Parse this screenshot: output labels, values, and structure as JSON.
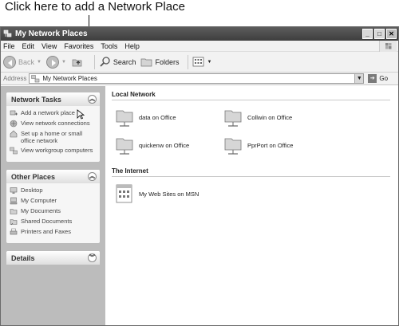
{
  "callout": {
    "text": "Click here to add a Network Place"
  },
  "window": {
    "title": "My Network Places",
    "buttons": {
      "minimize": "_",
      "maximize": "□",
      "close": "✕"
    }
  },
  "menu": [
    "File",
    "Edit",
    "View",
    "Favorites",
    "Tools",
    "Help"
  ],
  "toolbar": {
    "back": "Back",
    "search": "Search",
    "folders": "Folders"
  },
  "address": {
    "label": "Address",
    "value": "My Network Places",
    "go": "Go"
  },
  "sidebar": {
    "network_tasks": {
      "title": "Network Tasks",
      "items": [
        {
          "label": "Add a network place",
          "icon": "add-network-place-icon"
        },
        {
          "label": "View network connections",
          "icon": "network-connections-icon"
        },
        {
          "label": "Set up a home or small office network",
          "icon": "home-network-icon"
        },
        {
          "label": "View workgroup computers",
          "icon": "workgroup-icon"
        }
      ]
    },
    "other_places": {
      "title": "Other Places",
      "items": [
        {
          "label": "Desktop",
          "icon": "desktop-icon"
        },
        {
          "label": "My Computer",
          "icon": "computer-icon"
        },
        {
          "label": "My Documents",
          "icon": "documents-icon"
        },
        {
          "label": "Shared Documents",
          "icon": "shared-documents-icon"
        },
        {
          "label": "Printers and Faxes",
          "icon": "printer-icon"
        }
      ]
    },
    "details": {
      "title": "Details"
    }
  },
  "content": {
    "local_network": {
      "title": "Local Network",
      "items": [
        {
          "label": "data on Office"
        },
        {
          "label": "Collwin on Office"
        },
        {
          "label": "quickenw on Office"
        },
        {
          "label": "PprPort on Office"
        }
      ]
    },
    "internet": {
      "title": "The Internet",
      "items": [
        {
          "label": "My Web Sites on MSN"
        }
      ]
    }
  },
  "colors": {
    "titlebar": "#4a4a4a",
    "sidebar": "#bcbcbc",
    "panel": "#f6f6f6"
  }
}
